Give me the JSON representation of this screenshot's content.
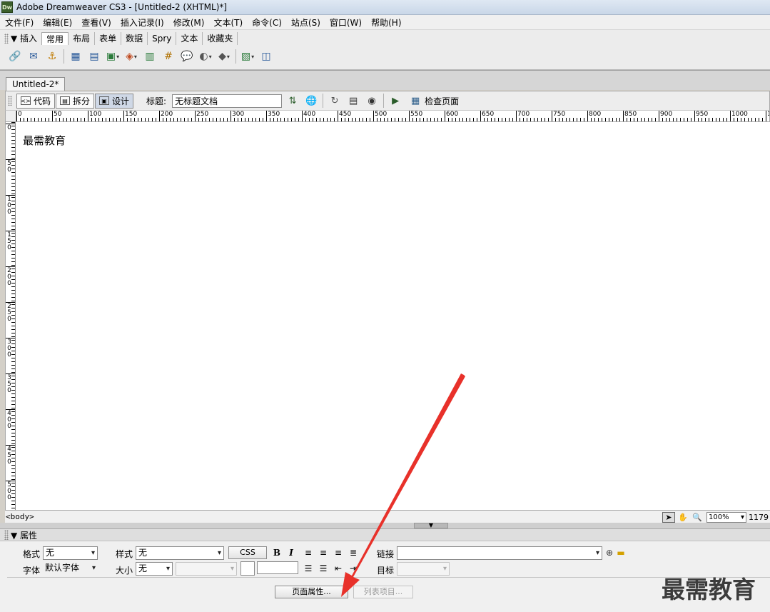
{
  "window": {
    "title": "Adobe Dreamweaver CS3 - [Untitled-2 (XHTML)*]",
    "logo": "Dw"
  },
  "menu": [
    "文件(F)",
    "编辑(E)",
    "查看(V)",
    "插入记录(I)",
    "修改(M)",
    "文本(T)",
    "命令(C)",
    "站点(S)",
    "窗口(W)",
    "帮助(H)"
  ],
  "insert_bar": {
    "toggle": "▼ 插入",
    "tabs": [
      "常用",
      "布局",
      "表单",
      "数据",
      "Spry",
      "文本",
      "收藏夹"
    ],
    "active_tab": "常用",
    "icons": [
      "hyperlink-icon",
      "email-link-icon",
      "named-anchor-icon",
      "table-icon",
      "insert-div-icon",
      "image-icon",
      "media-icon",
      "date-icon",
      "server-comment-icon",
      "comment-icon",
      "head-icon",
      "script-icon",
      "templates-icon",
      "tag-chooser-icon"
    ]
  },
  "document": {
    "tab_label": "Untitled-2*"
  },
  "doc_toolbar": {
    "code_label": "代码",
    "split_label": "拆分",
    "design_label": "设计",
    "title_label": "标题:",
    "title_value": "无标题文档",
    "check_page_label": "检查页面"
  },
  "ruler": {
    "h_labels": [
      "0",
      "50",
      "100",
      "150",
      "200",
      "250",
      "300",
      "350",
      "400",
      "450",
      "500",
      "550",
      "600",
      "650",
      "700",
      "750",
      "800",
      "850",
      "900",
      "950",
      "1000",
      "1"
    ],
    "v_labels": [
      "0",
      "50",
      "100",
      "150",
      "200",
      "250",
      "300",
      "350",
      "400",
      "450",
      "500"
    ]
  },
  "design_view": {
    "content": "最需教育"
  },
  "status_bar": {
    "tag": "<body>",
    "zoom": "100%",
    "window_size": "1179"
  },
  "properties": {
    "header": "▼ 属性",
    "format_label": "格式",
    "format_value": "无",
    "style_label": "样式",
    "style_value": "无",
    "css_button": "CSS",
    "bold_label": "B",
    "italic_label": "I",
    "link_label": "链接",
    "font_label": "字体",
    "font_value": "默认字体",
    "size_label": "大小",
    "size_value": "无",
    "target_label": "目标",
    "page_properties_button": "页面属性...",
    "list_item_button": "列表项目..."
  },
  "watermark": "最需教育",
  "colors": {
    "arrow": "#e8312a",
    "active_view": "#cfd8e6"
  }
}
